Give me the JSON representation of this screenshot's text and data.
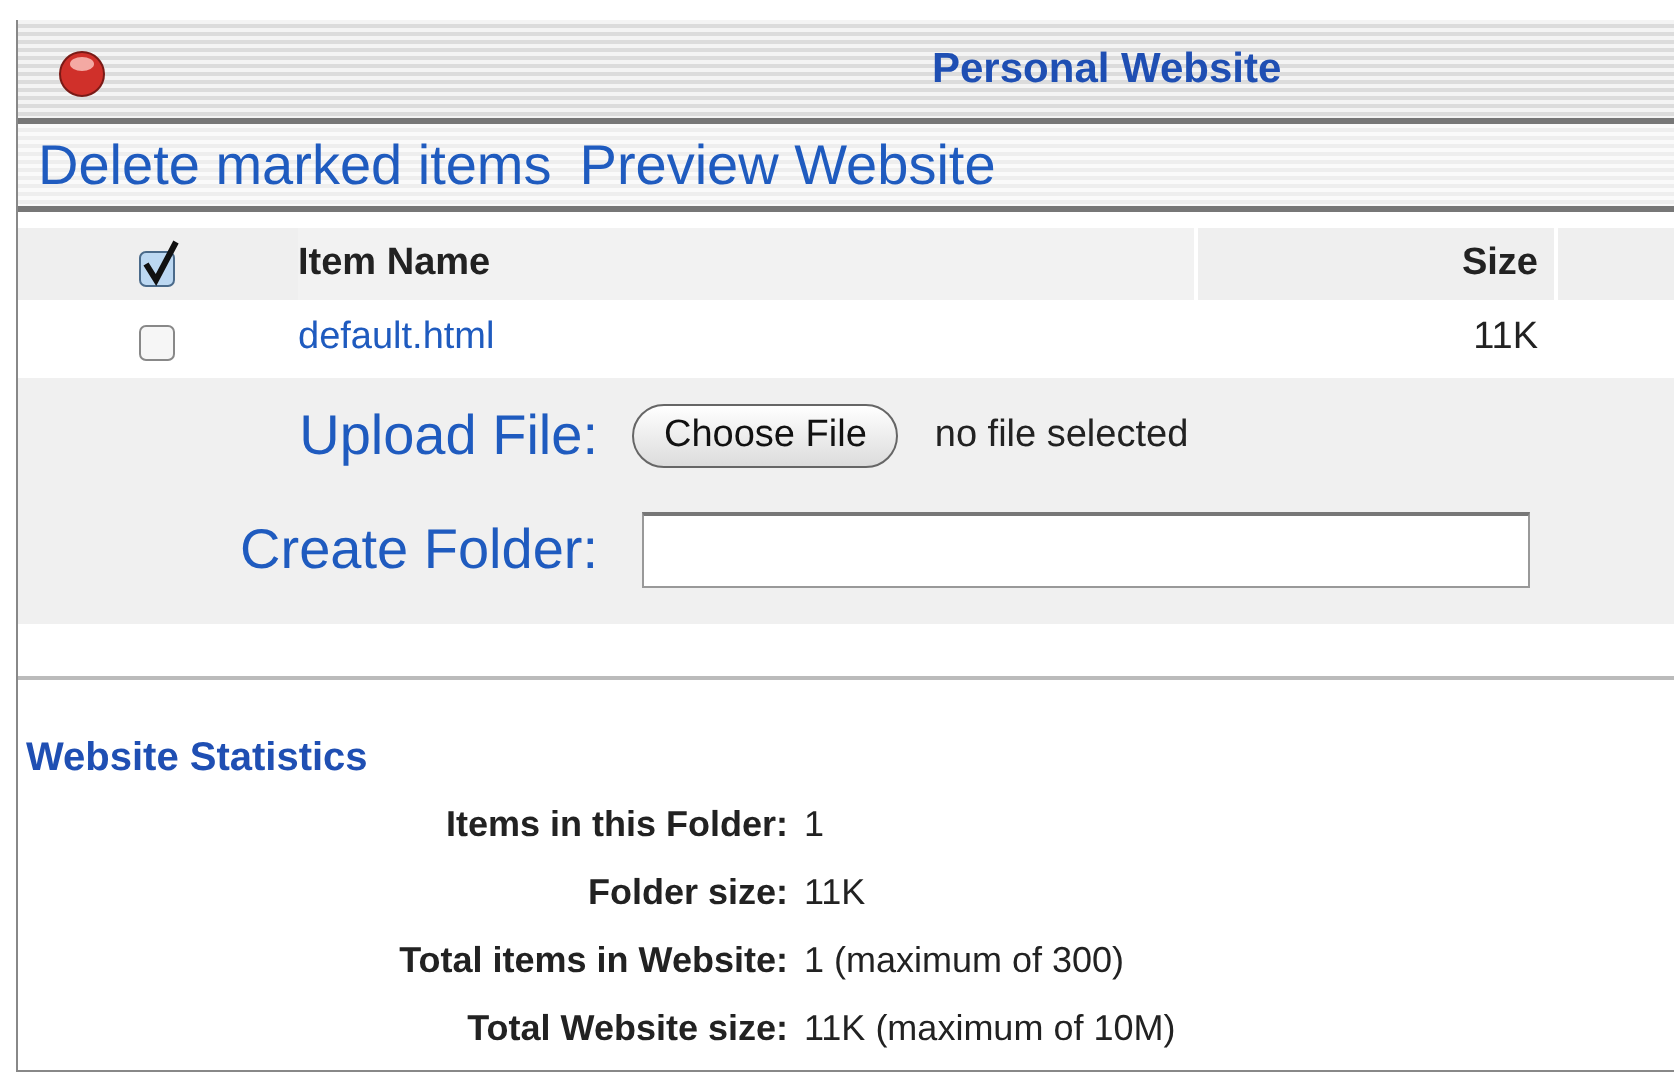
{
  "window": {
    "title": "Personal Website"
  },
  "actions": [
    "Delete marked items",
    "Preview Website"
  ],
  "table": {
    "select_all": {
      "checked": true
    },
    "columns": [
      "Item Name",
      "Size"
    ],
    "rows": [
      {
        "name": "default.html",
        "size": "11K",
        "checked": false
      }
    ]
  },
  "upload": {
    "label": "Upload File:",
    "button": "Choose File",
    "status": "no file selected"
  },
  "create_folder": {
    "label": "Create Folder:"
  },
  "statistics": {
    "title": "Website Statistics",
    "rows": [
      {
        "label": "Items in this Folder:",
        "value": "1"
      },
      {
        "label": "Folder size:",
        "value": "11K"
      },
      {
        "label": "Total items in Website:",
        "value": "1 (maximum of 300)"
      },
      {
        "label": "Total Website size:",
        "value": "11K (maximum of 10M)"
      }
    ]
  }
}
